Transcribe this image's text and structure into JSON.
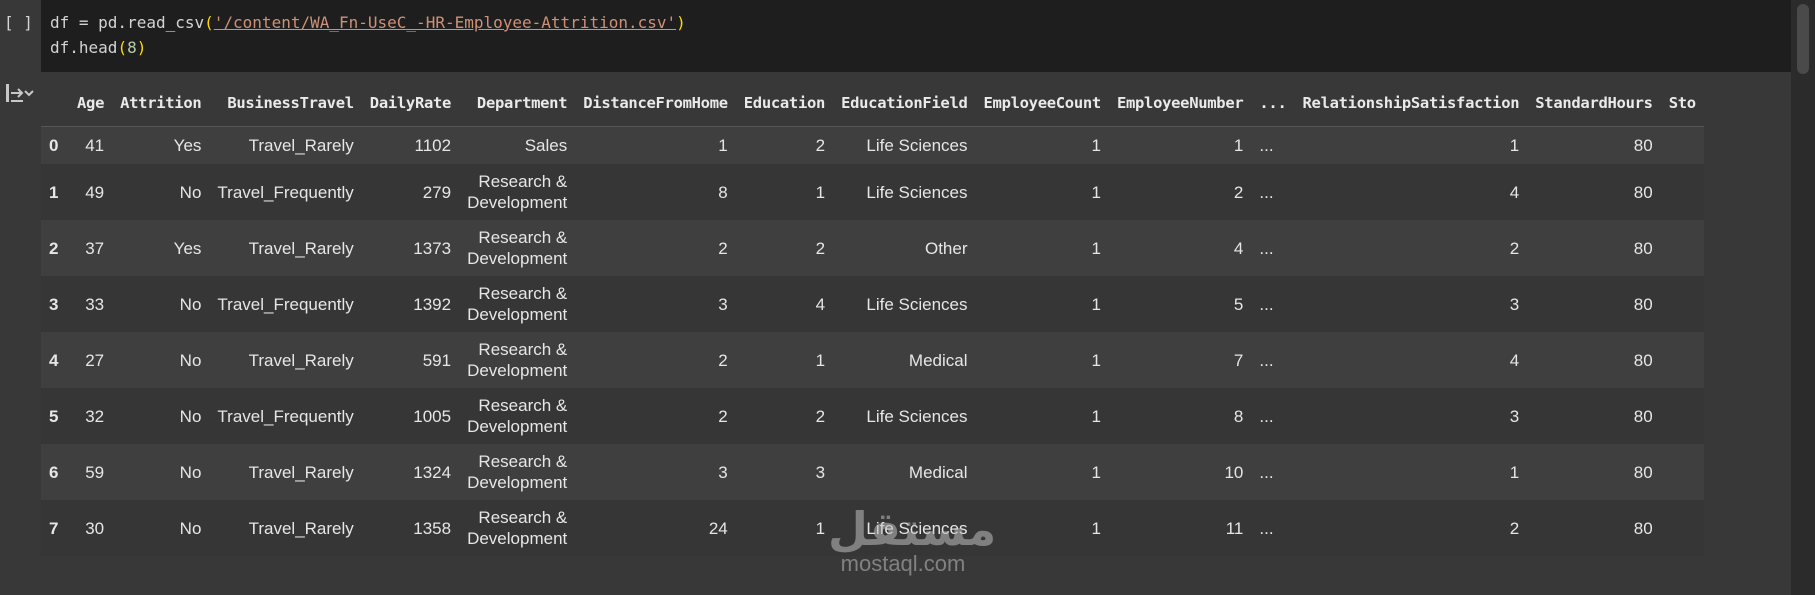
{
  "cell": {
    "bracket": "[ ]",
    "code_line1": {
      "prefix": "df = pd.read_csv",
      "open": "(",
      "path": "'/content/WA_Fn-UseC_-HR-Employee-Attrition.csv'",
      "close": ")"
    },
    "code_line2": {
      "prefix": "df.head",
      "open": "(",
      "arg": "8",
      "close": ")"
    }
  },
  "output_icon": "output-toggle-icon",
  "table": {
    "columns": [
      "",
      "Age",
      "Attrition",
      "BusinessTravel",
      "DailyRate",
      "Department",
      "DistanceFromHome",
      "Education",
      "EducationField",
      "EmployeeCount",
      "EmployeeNumber",
      "...",
      "RelationshipSatisfaction",
      "StandardHours",
      "Sto"
    ],
    "rows": [
      {
        "idx": "0",
        "age": "41",
        "attrition": "Yes",
        "travel": "Travel_Rarely",
        "rate": "1102",
        "dept1": "Sales",
        "dept2": "",
        "dist": "1",
        "edu": "2",
        "field": "Life Sciences",
        "count": "1",
        "number": "1",
        "ell": "...",
        "rel": "1",
        "hours": "80"
      },
      {
        "idx": "1",
        "age": "49",
        "attrition": "No",
        "travel": "Travel_Frequently",
        "rate": "279",
        "dept1": "Research &",
        "dept2": "Development",
        "dist": "8",
        "edu": "1",
        "field": "Life Sciences",
        "count": "1",
        "number": "2",
        "ell": "...",
        "rel": "4",
        "hours": "80"
      },
      {
        "idx": "2",
        "age": "37",
        "attrition": "Yes",
        "travel": "Travel_Rarely",
        "rate": "1373",
        "dept1": "Research &",
        "dept2": "Development",
        "dist": "2",
        "edu": "2",
        "field": "Other",
        "count": "1",
        "number": "4",
        "ell": "...",
        "rel": "2",
        "hours": "80"
      },
      {
        "idx": "3",
        "age": "33",
        "attrition": "No",
        "travel": "Travel_Frequently",
        "rate": "1392",
        "dept1": "Research &",
        "dept2": "Development",
        "dist": "3",
        "edu": "4",
        "field": "Life Sciences",
        "count": "1",
        "number": "5",
        "ell": "...",
        "rel": "3",
        "hours": "80"
      },
      {
        "idx": "4",
        "age": "27",
        "attrition": "No",
        "travel": "Travel_Rarely",
        "rate": "591",
        "dept1": "Research &",
        "dept2": "Development",
        "dist": "2",
        "edu": "1",
        "field": "Medical",
        "count": "1",
        "number": "7",
        "ell": "...",
        "rel": "4",
        "hours": "80"
      },
      {
        "idx": "5",
        "age": "32",
        "attrition": "No",
        "travel": "Travel_Frequently",
        "rate": "1005",
        "dept1": "Research &",
        "dept2": "Development",
        "dist": "2",
        "edu": "2",
        "field": "Life Sciences",
        "count": "1",
        "number": "8",
        "ell": "...",
        "rel": "3",
        "hours": "80"
      },
      {
        "idx": "6",
        "age": "59",
        "attrition": "No",
        "travel": "Travel_Rarely",
        "rate": "1324",
        "dept1": "Research &",
        "dept2": "Development",
        "dist": "3",
        "edu": "3",
        "field": "Medical",
        "count": "1",
        "number": "10",
        "ell": "...",
        "rel": "1",
        "hours": "80"
      },
      {
        "idx": "7",
        "age": "30",
        "attrition": "No",
        "travel": "Travel_Rarely",
        "rate": "1358",
        "dept1": "Research &",
        "dept2": "Development",
        "dist": "24",
        "edu": "1",
        "field": "Life Sciences",
        "count": "1",
        "number": "11",
        "ell": "...",
        "rel": "2",
        "hours": "80"
      }
    ]
  },
  "watermark": {
    "arabic": "مستقل",
    "latin": "mostaql.com"
  },
  "colors": {
    "background": "#383838",
    "editor": "#1e1e1e",
    "string": "#ce9178",
    "bracket": "#ffd700",
    "number": "#b5cea8"
  }
}
